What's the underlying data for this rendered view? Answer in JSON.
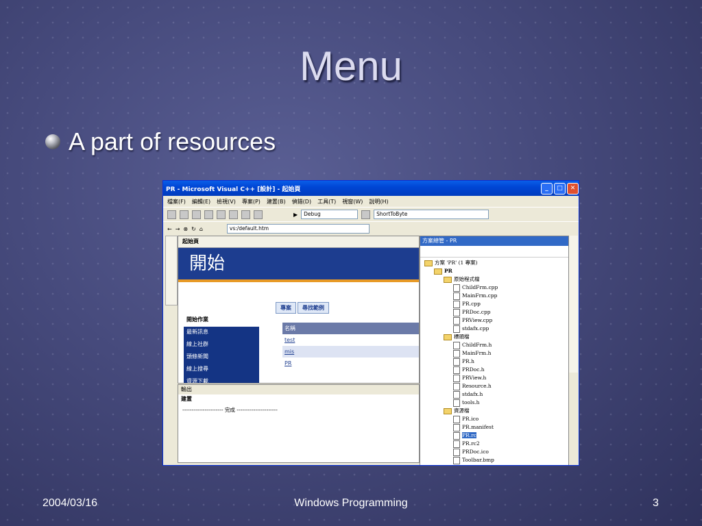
{
  "slide": {
    "title": "Menu",
    "bullet": "A part of resources",
    "footer_date": "2004/03/16",
    "footer_center": "Windows Programming",
    "page_number": "3"
  },
  "window": {
    "title": "PR - Microsoft Visual C++ [設計] - 起始頁",
    "menu": [
      "檔案(F)",
      "編輯(E)",
      "檢視(V)",
      "專案(P)",
      "建置(B)",
      "偵錯(D)",
      "工具(T)",
      "視窗(W)",
      "說明(H)"
    ],
    "build_config": "Debug",
    "find_combo": "ShortToByte",
    "url": "vs:/default.htm",
    "doc_tab": "起始頁",
    "banner_text": "開始",
    "nav": [
      "開始作業",
      "最新訊息",
      "線上社群",
      "頭條新聞",
      "線上搜尋",
      "資源下載"
    ],
    "tabs": [
      "專案",
      "尋找範例"
    ],
    "grid_header": "名稱",
    "grid_rows": [
      "test",
      "mis",
      "PR"
    ],
    "output_title": "輸出",
    "output_pane": "建置",
    "output_line": "---------------------- 完成 ----------------------",
    "solution_title": "方案總管 - PR",
    "tree": [
      {
        "text": "方案 'PR' (1 專案)",
        "level": 0,
        "kind": "sol"
      },
      {
        "text": "PR",
        "level": 1,
        "kind": "proj"
      },
      {
        "text": "原始程式檔",
        "level": 2,
        "kind": "folder"
      },
      {
        "text": "ChildFrm.cpp",
        "level": 3,
        "kind": "file"
      },
      {
        "text": "MainFrm.cpp",
        "level": 3,
        "kind": "file"
      },
      {
        "text": "PR.cpp",
        "level": 3,
        "kind": "file"
      },
      {
        "text": "PRDoc.cpp",
        "level": 3,
        "kind": "file"
      },
      {
        "text": "PRView.cpp",
        "level": 3,
        "kind": "file"
      },
      {
        "text": "stdafx.cpp",
        "level": 3,
        "kind": "file"
      },
      {
        "text": "標頭檔",
        "level": 2,
        "kind": "folder"
      },
      {
        "text": "ChildFrm.h",
        "level": 3,
        "kind": "file"
      },
      {
        "text": "MainFrm.h",
        "level": 3,
        "kind": "file"
      },
      {
        "text": "PR.h",
        "level": 3,
        "kind": "file"
      },
      {
        "text": "PRDoc.h",
        "level": 3,
        "kind": "file"
      },
      {
        "text": "PRView.h",
        "level": 3,
        "kind": "file"
      },
      {
        "text": "Resource.h",
        "level": 3,
        "kind": "file"
      },
      {
        "text": "stdafx.h",
        "level": 3,
        "kind": "file"
      },
      {
        "text": "tools.h",
        "level": 3,
        "kind": "file"
      },
      {
        "text": "資源檔",
        "level": 2,
        "kind": "folder"
      },
      {
        "text": "PR.ico",
        "level": 3,
        "kind": "file"
      },
      {
        "text": "PR.manifest",
        "level": 3,
        "kind": "file"
      },
      {
        "text": "PR.rc",
        "level": 3,
        "kind": "file",
        "selected": true
      },
      {
        "text": "PR.rc2",
        "level": 3,
        "kind": "file"
      },
      {
        "text": "PRDoc.ico",
        "level": 3,
        "kind": "file"
      },
      {
        "text": "Toolbar.bmp",
        "level": 3,
        "kind": "file"
      }
    ]
  }
}
